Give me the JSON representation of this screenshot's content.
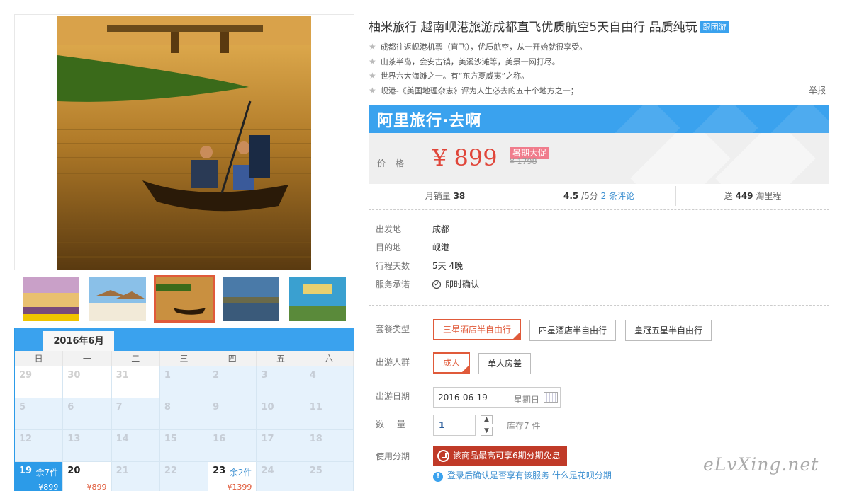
{
  "product": {
    "title": "柚米旅行 越南岘港旅游成都直飞优质航空5天自由行 品质纯玩",
    "tag": "跟团游",
    "features": [
      "成都往返岘港机票（直飞），优质航空，从一开始就很享受。",
      "山茶半岛，会安古镇，美溪沙滩等，美景一网打尽。",
      "世界六大海滩之一。有“东方夏威夷”之称。",
      "岘港-《美国地理杂志》评为人生必去的五十个地方之一；"
    ],
    "report_label": "举报"
  },
  "brand": {
    "text": "阿里旅行·去啊",
    "color": "#3aa2ee"
  },
  "price": {
    "label": "价格",
    "current": "¥ 899",
    "promo": "暑期大促",
    "original": "¥ 1798"
  },
  "stats": {
    "monthly_sales_label": "月销量",
    "monthly_sales": "38",
    "rating": "4.5",
    "rating_suffix": "/5分",
    "reviews": "2 条评论",
    "miles_prefix": "送",
    "miles": "449",
    "miles_suffix": "淘里程"
  },
  "info": [
    {
      "key": "出发地",
      "value": "成都"
    },
    {
      "key": "目的地",
      "value": "岘港"
    },
    {
      "key": "行程天数",
      "value": "5天 4晚"
    },
    {
      "key": "服务承诺",
      "value": "即时确认"
    }
  ],
  "options": {
    "package_label": "套餐类型",
    "packages": [
      "三星酒店半自由行",
      "四星酒店半自由行",
      "皇冠五星半自由行"
    ],
    "group_label": "出游人群",
    "groups": [
      "成人",
      "单人房差"
    ],
    "date_label": "出游日期",
    "date_value": "2016-06-19",
    "date_weekday": "星期日",
    "qty_label": "数量",
    "qty_value": "1",
    "qty_up": "▲",
    "qty_down": "▼",
    "stock": "库存7 件",
    "installment_label": "使用分期",
    "installment_text": "该商品最高可享6期分期免息",
    "notice_info": "!",
    "notice_text": "登录后确认是否享有该服务",
    "notice_link": "什么是花呗分期"
  },
  "calendar": {
    "month": "2016年6月",
    "weekdays": [
      "日",
      "一",
      "二",
      "三",
      "四",
      "五",
      "六"
    ],
    "days": [
      {
        "d": "29"
      },
      {
        "d": "30"
      },
      {
        "d": "31"
      },
      {
        "d": "1"
      },
      {
        "d": "2"
      },
      {
        "d": "3"
      },
      {
        "d": "4"
      },
      {
        "d": "5"
      },
      {
        "d": "6"
      },
      {
        "d": "7"
      },
      {
        "d": "8"
      },
      {
        "d": "9"
      },
      {
        "d": "10"
      },
      {
        "d": "11"
      },
      {
        "d": "12"
      },
      {
        "d": "13"
      },
      {
        "d": "14"
      },
      {
        "d": "15"
      },
      {
        "d": "16"
      },
      {
        "d": "17"
      },
      {
        "d": "18"
      },
      {
        "d": "19",
        "stock": "余7件",
        "price": "¥899",
        "selected": true
      },
      {
        "d": "20",
        "price": "¥899"
      },
      {
        "d": "21"
      },
      {
        "d": "22"
      },
      {
        "d": "23",
        "stock": "余2件",
        "price": "¥1399"
      },
      {
        "d": "24"
      },
      {
        "d": "25"
      }
    ]
  },
  "watermark": "eLvXing.net"
}
